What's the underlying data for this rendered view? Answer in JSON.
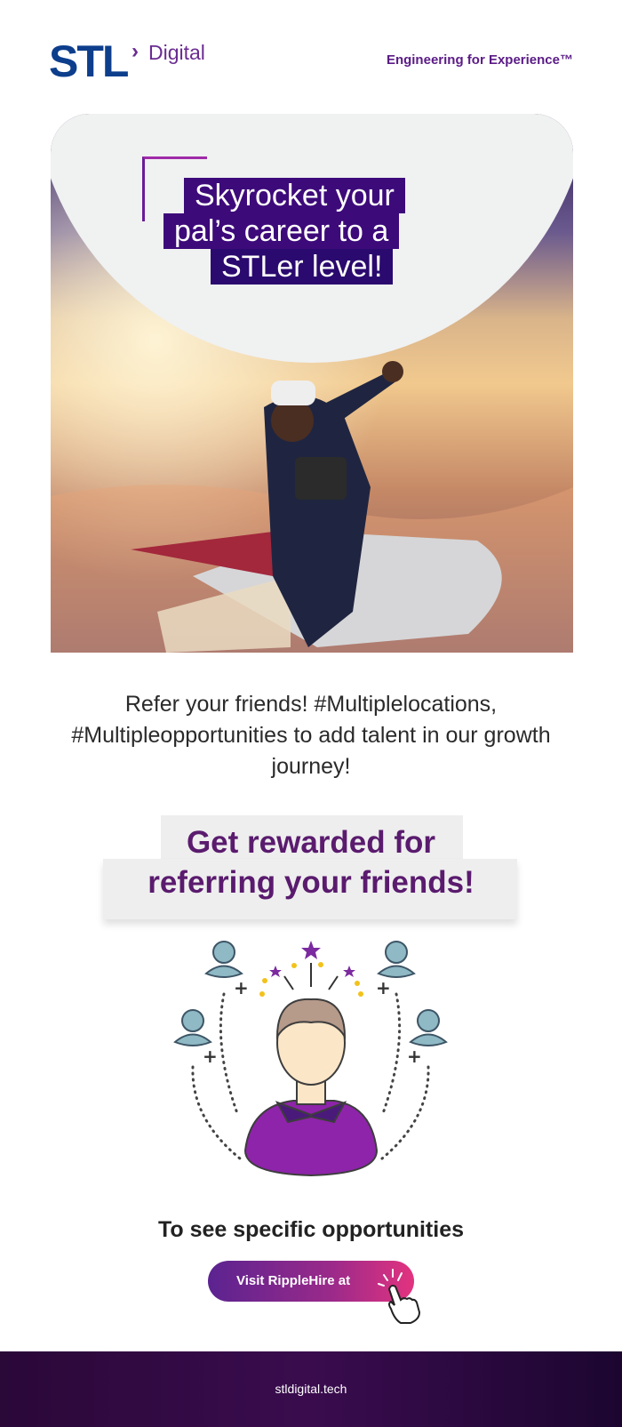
{
  "header": {
    "logo_main": "STL",
    "logo_sub": "Digital",
    "tagline": "Engineering for Experience™"
  },
  "hero": {
    "headline_line1": "Skyrocket your",
    "headline_line2": "pal’s career to a",
    "headline_line3": "STLer level!"
  },
  "intro": {
    "text": "Refer your friends! #Multiplelocations, #Multipleopportunities to add talent in our growth journey!"
  },
  "reward": {
    "line1": "Get rewarded for",
    "line2": "referring your friends!"
  },
  "cta": {
    "heading": "To see specific opportunities",
    "button_label": "Visit RippleHire at"
  },
  "footer": {
    "link": "stldigital.tech"
  },
  "colors": {
    "brand_blue": "#0d3e8c",
    "brand_purple": "#5a1b86",
    "headline_bg": "#3d0a7a",
    "footer_bg": "#2a0838"
  },
  "icons": [
    "user-icon",
    "sparkle-icon",
    "pointer-hand-icon"
  ]
}
